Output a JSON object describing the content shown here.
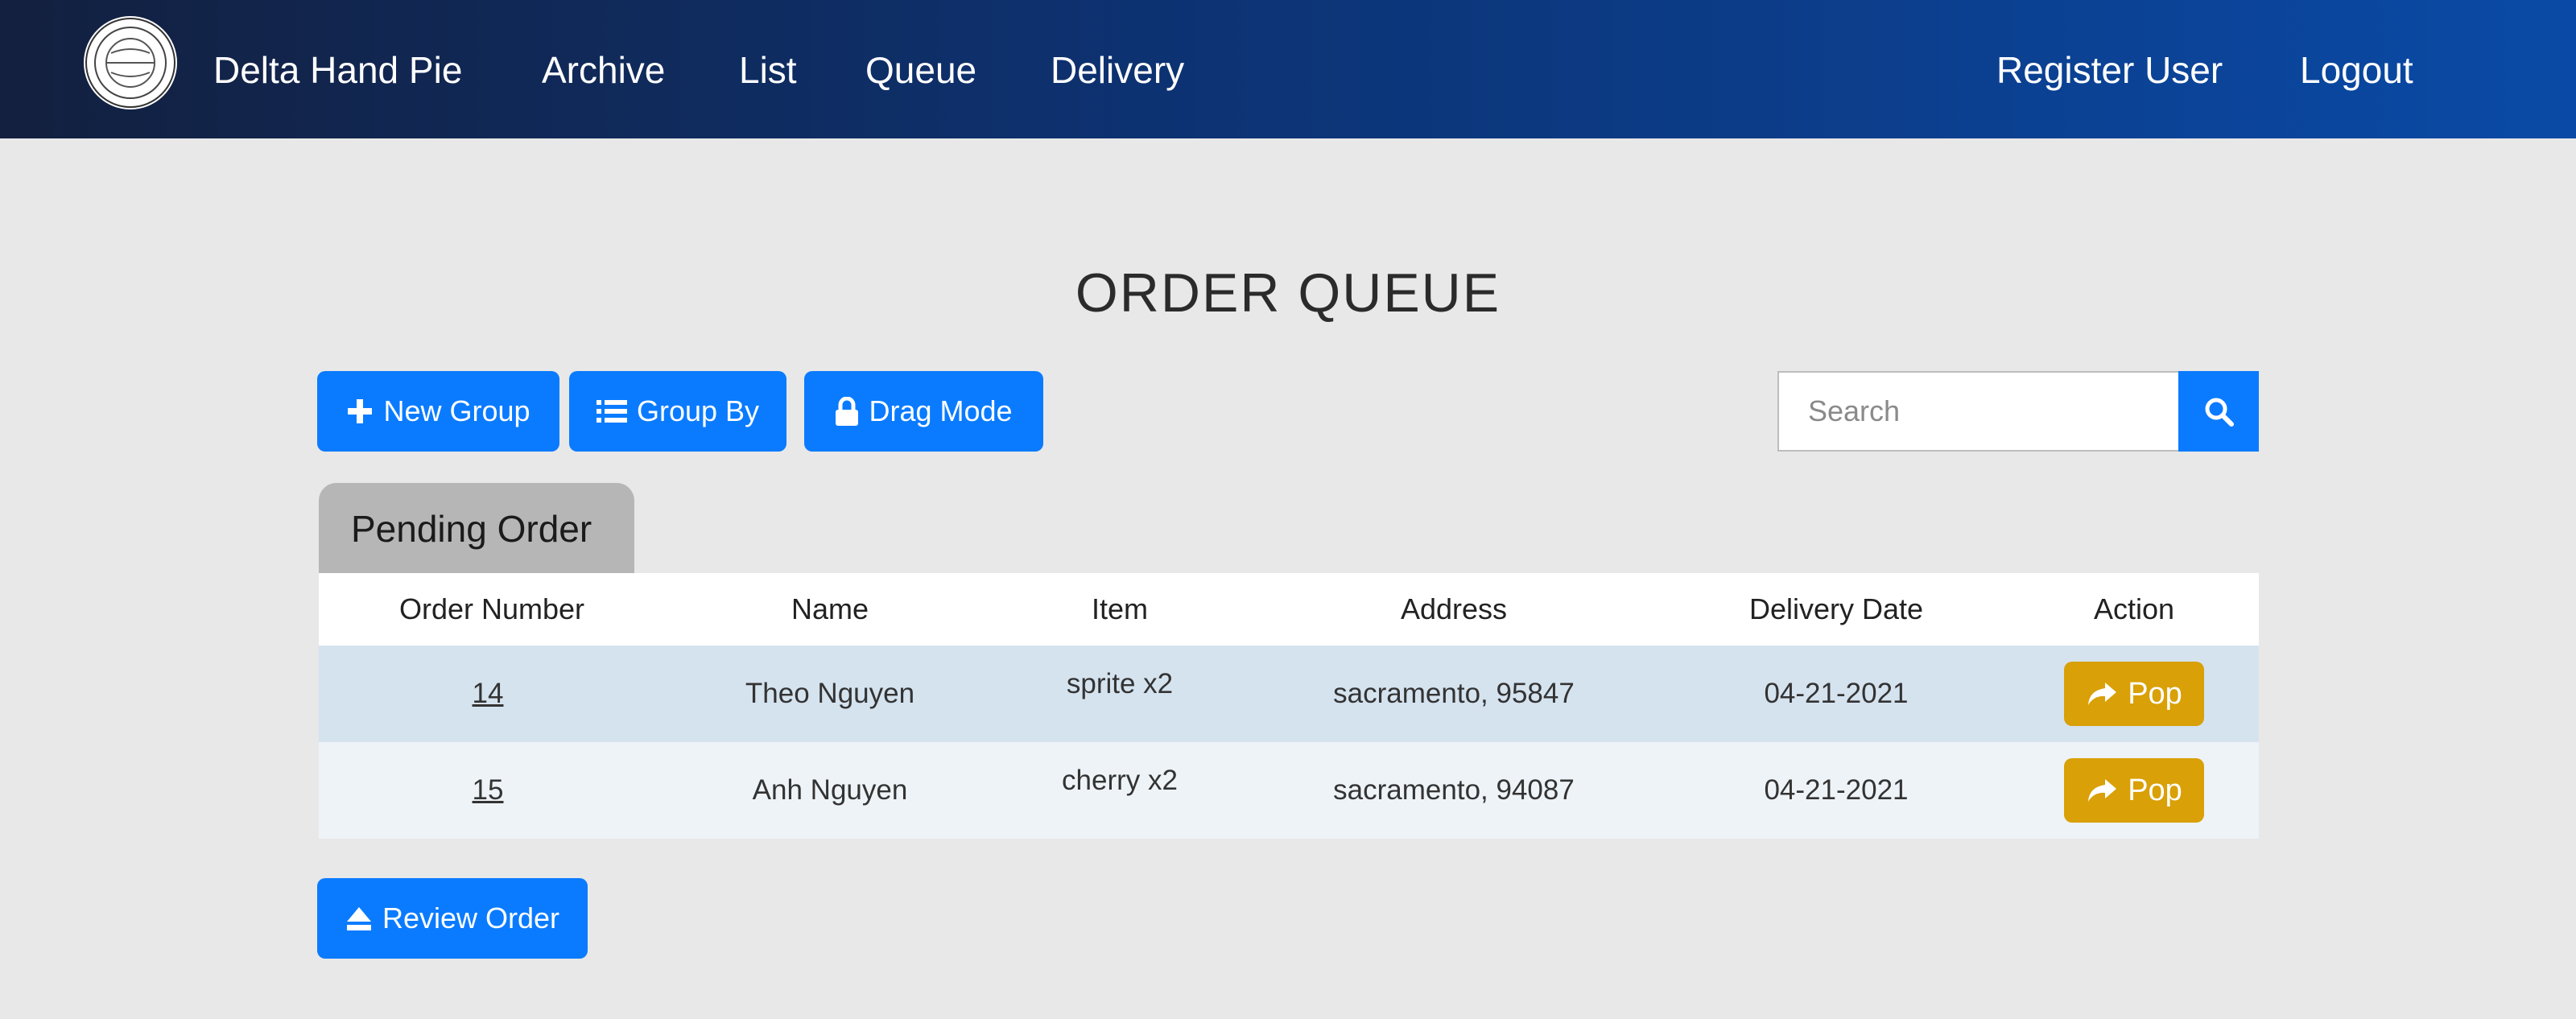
{
  "nav": {
    "brand": "Delta Hand Pie",
    "links": [
      "Archive",
      "List",
      "Queue",
      "Delivery"
    ],
    "right_links": [
      "Register User",
      "Logout"
    ],
    "logo_text": "DELTA HAND PIES"
  },
  "page": {
    "title": "ORDER QUEUE"
  },
  "toolbar": {
    "new_group": "New Group",
    "group_by": "Group By",
    "drag_mode": "Drag Mode",
    "search_placeholder": "Search"
  },
  "group": {
    "label": "Pending Order",
    "columns": [
      "Order Number",
      "Name",
      "Item",
      "Address",
      "Delivery Date",
      "Action"
    ],
    "rows": [
      {
        "order_number": "14",
        "name": "Theo Nguyen",
        "item": "sprite x2",
        "address": "sacramento, 95847",
        "delivery_date": "04-21-2021",
        "action": "Pop"
      },
      {
        "order_number": "15",
        "name": "Anh Nguyen",
        "item": "cherry x2",
        "address": "sacramento, 94087",
        "delivery_date": "04-21-2021",
        "action": "Pop"
      }
    ]
  },
  "footer": {
    "review_order": "Review Order"
  },
  "colors": {
    "primary": "#0a7bff",
    "warning": "#d9a007",
    "nav_start": "#13203f",
    "nav_end": "#0a4aa6"
  },
  "icons": [
    "plus-icon",
    "list-icon",
    "lock-icon",
    "search-icon",
    "share-icon",
    "eject-icon"
  ]
}
